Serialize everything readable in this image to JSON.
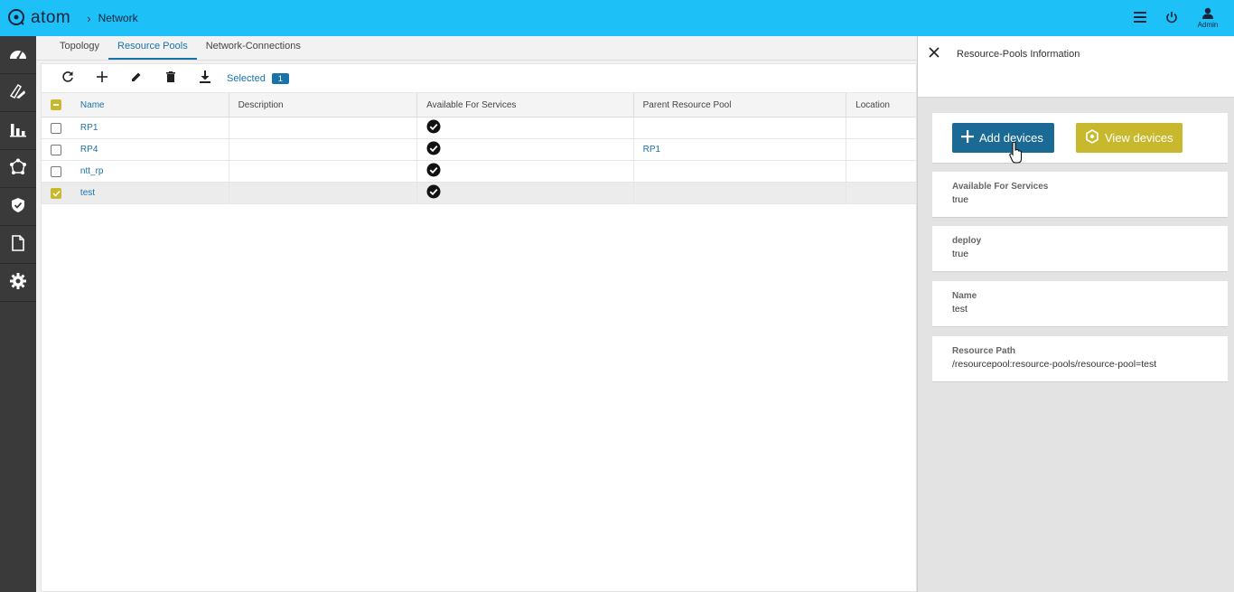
{
  "header": {
    "app_name": "atom",
    "breadcrumb": "Network",
    "user_label": "Admin"
  },
  "sidebar": {
    "items": [
      {
        "icon": "dashboard-icon"
      },
      {
        "icon": "resources-icon"
      },
      {
        "icon": "analytics-icon"
      },
      {
        "icon": "topology-icon"
      },
      {
        "icon": "security-icon"
      },
      {
        "icon": "document-icon"
      },
      {
        "icon": "settings-icon"
      }
    ]
  },
  "tabs": [
    {
      "label": "Topology",
      "active": false
    },
    {
      "label": "Resource Pools",
      "active": true
    },
    {
      "label": "Network-Connections",
      "active": false
    }
  ],
  "toolbar": {
    "selected_label": "Selected",
    "selected_count": "1"
  },
  "table": {
    "columns": [
      "Name",
      "Description",
      "Available For Services",
      "Parent Resource Pool",
      "Location"
    ],
    "rows": [
      {
        "name": "RP1",
        "description": "",
        "available": true,
        "parent": "",
        "location": "",
        "checked": false
      },
      {
        "name": "RP4",
        "description": "",
        "available": true,
        "parent": "RP1",
        "location": "",
        "checked": false
      },
      {
        "name": "ntt_rp",
        "description": "",
        "available": true,
        "parent": "",
        "location": "",
        "checked": false
      },
      {
        "name": "test",
        "description": "",
        "available": true,
        "parent": "",
        "location": "",
        "checked": true
      }
    ]
  },
  "details": {
    "title": "Resource-Pools Information",
    "add_button": "Add devices",
    "view_button": "View devices",
    "fields": [
      {
        "label": "Available For Services",
        "value": "true"
      },
      {
        "label": "deploy",
        "value": "true"
      },
      {
        "label": "Name",
        "value": "test"
      },
      {
        "label": "Resource Path",
        "value": "/resourcepool:resource-pools/resource-pool=test"
      }
    ]
  },
  "colors": {
    "header": "#1ec0f8",
    "sidebar": "#3a3a3a",
    "accent_blue": "#1a73a8",
    "accent_olive": "#c8b82e"
  }
}
